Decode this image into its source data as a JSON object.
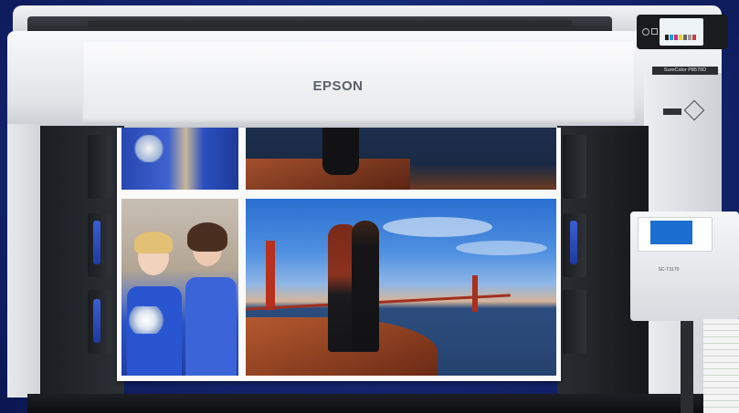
{
  "printer": {
    "brand": "EPSON",
    "model_label": "SureColor P8570D"
  },
  "second_printer": {
    "model_label": "SC-T3170"
  },
  "colors": {
    "background": "#172a78",
    "printer_body": "#e2e4e8",
    "dark_panel": "#1c1e22",
    "roll_accent": "#2f4fc0"
  }
}
